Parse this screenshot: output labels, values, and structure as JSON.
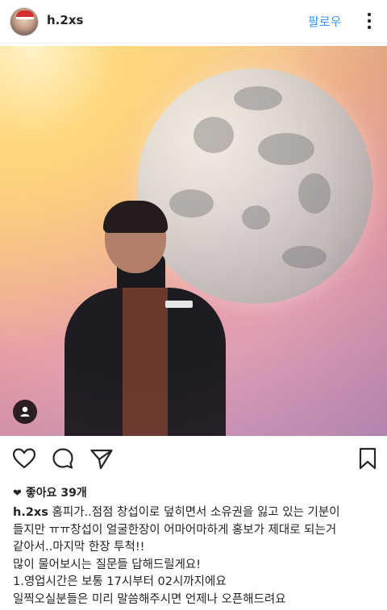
{
  "header": {
    "username": "h.2xs",
    "follow_label": "팔로우"
  },
  "icons": {
    "more": "more-vertical-icon",
    "like": "heart-outline-icon",
    "comment": "comment-icon",
    "share": "direct-share-icon",
    "save": "bookmark-icon",
    "tagged": "person-icon"
  },
  "colors": {
    "accent": "#3897f0",
    "text": "#262626"
  },
  "post": {
    "likes": "좋아요 39개",
    "caption_user": "h.2xs",
    "caption_lines": [
      "홈피가..점점 창섭이로 덮히면서 소유권을 잃고 있는 기분이",
      "들지만 ㅠㅠ창섭이 얼굴한장이 어마어마하게 홍보가 제대로 되는거",
      "같아서..마지막 한장 투척!!",
      "많이 물어보시는 질문들 답해드릴게요!",
      "1.영업시간은 보통 17시부터 02시까지에요",
      "일찍오실분들은 미리 말씀해주시면 언제나 오픈해드려요"
    ]
  }
}
